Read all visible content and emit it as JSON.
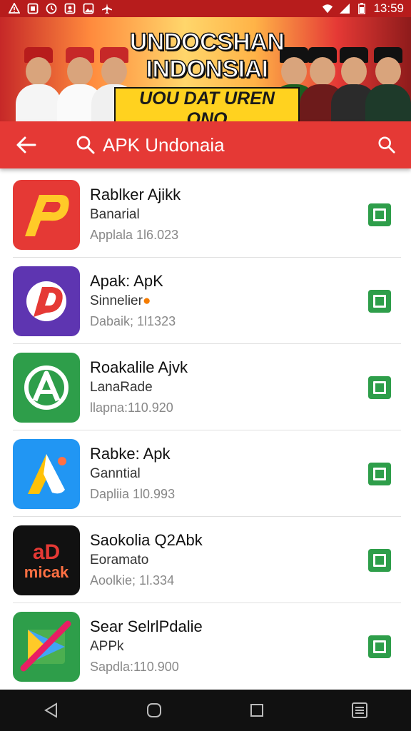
{
  "status_bar": {
    "time": "13:59",
    "icons_left": [
      "alert-icon",
      "gallery-icon",
      "timer-icon",
      "contacts-icon",
      "image-icon",
      "airplane-icon"
    ],
    "icons_right": [
      "wifi-signal-icon",
      "cell-signal-icon",
      "battery-icon"
    ]
  },
  "banner": {
    "line1": "UNDOCSHAN",
    "line2": "INDONSIAI",
    "line3": "UOU DAT UREN ONO"
  },
  "search": {
    "query": "APK Undonaia",
    "icons": [
      "back-arrow-icon",
      "search-icon",
      "search-icon"
    ]
  },
  "apps": [
    {
      "title": "Rablker Ajikk",
      "subtitle": "Banarial",
      "meta": "Applala 1l6.023",
      "icon_colors": [
        "#e53935",
        "#ffca28"
      ]
    },
    {
      "title": "Apak: ApK",
      "subtitle": "Sinnelier",
      "meta": "Dabaik; 1l1323",
      "icon_colors": [
        "#5e35b1",
        "#e53935"
      ]
    },
    {
      "title": "Roakalile Ajvk",
      "subtitle": "LanaRade",
      "meta": "llapna:110.920",
      "icon_colors": [
        "#2e9e4a",
        "#ffffff"
      ]
    },
    {
      "title": "Rabke: Apk",
      "subtitle": "Ganntial",
      "meta": "Dapliia 1l0.993",
      "icon_colors": [
        "#2196f3",
        "#ffc107"
      ]
    },
    {
      "title": "Saokolia Q2Abk",
      "subtitle": "Eoramato",
      "meta": "Aoolkie; 1l.334",
      "icon_colors": [
        "#111111",
        "#e53935"
      ]
    },
    {
      "title": "Sear SelrlPdalie",
      "subtitle": "APPk",
      "meta": "Sapdla:110.900",
      "icon_colors": [
        "#2e9e4a",
        "#e91e63"
      ]
    }
  ],
  "nav": {
    "icons": [
      "back-triangle-icon",
      "home-circle-icon",
      "recents-square-icon",
      "menu-list-icon"
    ]
  },
  "colors": {
    "status_bar": "#b71c1c",
    "header": "#e53935",
    "install": "#2e9e4a",
    "navbar": "#111111"
  }
}
